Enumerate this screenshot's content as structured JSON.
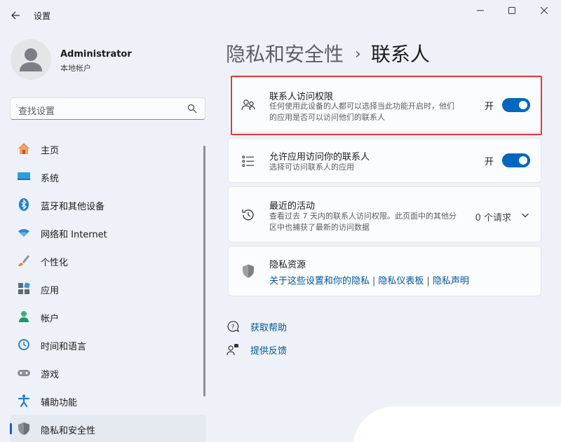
{
  "window": {
    "title": "设置"
  },
  "profile": {
    "name": "Administrator",
    "account_type": "本地帐户"
  },
  "search": {
    "placeholder": "查找设置"
  },
  "sidebar": {
    "items": [
      {
        "label": "主页",
        "icon": "home-icon"
      },
      {
        "label": "系统",
        "icon": "system-icon"
      },
      {
        "label": "蓝牙和其他设备",
        "icon": "bluetooth-icon"
      },
      {
        "label": "网络和 Internet",
        "icon": "wifi-icon"
      },
      {
        "label": "个性化",
        "icon": "brush-icon"
      },
      {
        "label": "应用",
        "icon": "apps-icon"
      },
      {
        "label": "帐户",
        "icon": "account-icon"
      },
      {
        "label": "时间和语言",
        "icon": "clock-icon"
      },
      {
        "label": "游戏",
        "icon": "gamepad-icon"
      },
      {
        "label": "辅助功能",
        "icon": "accessibility-icon"
      },
      {
        "label": "隐私和安全性",
        "icon": "shield-icon",
        "active": true
      }
    ]
  },
  "breadcrumb": {
    "parent": "隐私和安全性",
    "separator": "›",
    "current": "联系人"
  },
  "cards": {
    "contacts_access": {
      "title": "联系人访问权限",
      "description": "任何使用此设备的人都可以选择当此功能开启时，他们的应用是否可以访问他们的联系人",
      "state": "开"
    },
    "app_access": {
      "title": "允许应用访问你的联系人",
      "description": "选择可访问联系人的应用",
      "state": "开"
    },
    "recent_activity": {
      "title": "最近的活动",
      "description": "查看过去 7 天内的联系人访问权限。此页面中的其他分区中也捕获了最新的访问数据",
      "count": "0 个请求"
    },
    "privacy_resources": {
      "title": "隐私资源",
      "links": [
        "关于这些设置和你的隐私",
        "隐私仪表板",
        "隐私声明"
      ],
      "separator": "|"
    }
  },
  "help": {
    "get_help": "获取帮助",
    "feedback": "提供反馈"
  },
  "colors": {
    "accent": "#0067c0",
    "link": "#0056a3",
    "highlight": "#e03a3a"
  }
}
